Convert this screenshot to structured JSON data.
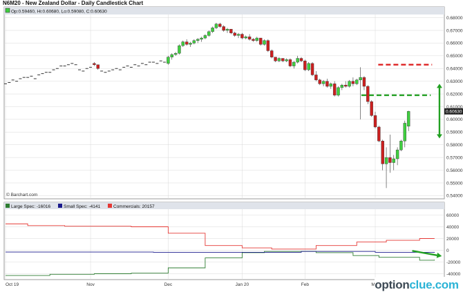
{
  "header": {
    "title": "N6M20 - New Zealand Dollar - Daily Candlestick Chart",
    "ohlc_label": "Op:0.59460, Hi:0.60680, Lo:0.59080, C:0.60630",
    "copyright": "© Barchart.com"
  },
  "watermark": {
    "part1": "option",
    "part2": "clue.com"
  },
  "colors": {
    "up": "#3fcf3f",
    "down": "#cc1f1f",
    "large_spec": "#2e7d32",
    "small_spec": "#1a1a8c",
    "commercials": "#e53935",
    "annotation_red": "#dd2020",
    "annotation_green": "#22a022",
    "grid": "#d8d8d8"
  },
  "chart_data": [
    {
      "type": "candlestick",
      "title": "N6M20 - New Zealand Dollar - Daily Candlestick Chart",
      "ylim": [
        0.5375,
        0.6825
      ],
      "y_ticks": [
        "0.54000",
        "0.55000",
        "0.56000",
        "0.57000",
        "0.58000",
        "0.59000",
        "0.60000",
        "0.61000",
        "0.62000",
        "0.63000",
        "0.64000",
        "0.65000",
        "0.66000",
        "0.67000",
        "0.68000"
      ],
      "last_price": "0.60630",
      "candles": [
        [
          0.628,
          0.628,
          0.628,
          0.628
        ],
        [
          0.629,
          0.629,
          0.629,
          0.629
        ],
        [
          0.631,
          0.631,
          0.631,
          0.631
        ],
        [
          0.63,
          0.63,
          0.63,
          0.63
        ],
        [
          0.632,
          0.632,
          0.632,
          0.632
        ],
        [
          0.633,
          0.633,
          0.633,
          0.633
        ],
        [
          0.633,
          0.633,
          0.633,
          0.633
        ],
        [
          0.634,
          0.634,
          0.634,
          0.634
        ],
        [
          0.632,
          0.632,
          0.632,
          0.632
        ],
        [
          0.635,
          0.635,
          0.635,
          0.635
        ],
        [
          0.636,
          0.636,
          0.636,
          0.636
        ],
        [
          0.637,
          0.637,
          0.637,
          0.637
        ],
        [
          0.637,
          0.637,
          0.637,
          0.637
        ],
        [
          0.639,
          0.639,
          0.639,
          0.639
        ],
        [
          0.64,
          0.64,
          0.64,
          0.64
        ],
        [
          0.642,
          0.642,
          0.642,
          0.642
        ],
        [
          0.642,
          0.642,
          0.642,
          0.642
        ],
        [
          0.643,
          0.643,
          0.643,
          0.643
        ],
        [
          0.644,
          0.644,
          0.644,
          0.644
        ],
        [
          0.643,
          0.643,
          0.643,
          0.643
        ],
        [
          0.639,
          0.639,
          0.639,
          0.639
        ],
        [
          0.638,
          0.638,
          0.638,
          0.638
        ],
        [
          0.64,
          0.64,
          0.64,
          0.64
        ],
        [
          0.641,
          0.641,
          0.641,
          0.641
        ],
        [
          0.644,
          0.645,
          0.642,
          0.643
        ],
        [
          0.643,
          0.643,
          0.639,
          0.64
        ],
        [
          0.638,
          0.638,
          0.638,
          0.638
        ],
        [
          0.637,
          0.637,
          0.637,
          0.637
        ],
        [
          0.638,
          0.638,
          0.638,
          0.638
        ],
        [
          0.639,
          0.639,
          0.639,
          0.639
        ],
        [
          0.64,
          0.64,
          0.64,
          0.64
        ],
        [
          0.639,
          0.639,
          0.639,
          0.639
        ],
        [
          0.641,
          0.641,
          0.641,
          0.641
        ],
        [
          0.642,
          0.642,
          0.642,
          0.642
        ],
        [
          0.641,
          0.641,
          0.641,
          0.641
        ],
        [
          0.643,
          0.643,
          0.643,
          0.643
        ],
        [
          0.642,
          0.642,
          0.642,
          0.642
        ],
        [
          0.644,
          0.644,
          0.644,
          0.644
        ],
        [
          0.643,
          0.643,
          0.643,
          0.643
        ],
        [
          0.645,
          0.645,
          0.645,
          0.645
        ],
        [
          0.645,
          0.645,
          0.645,
          0.645
        ],
        [
          0.644,
          0.644,
          0.644,
          0.644
        ],
        [
          0.646,
          0.646,
          0.646,
          0.646
        ],
        [
          0.645,
          0.645,
          0.645,
          0.645
        ],
        [
          0.644,
          0.65,
          0.643,
          0.649
        ],
        [
          0.649,
          0.652,
          0.647,
          0.651
        ],
        [
          0.651,
          0.653,
          0.65,
          0.652
        ],
        [
          0.652,
          0.659,
          0.651,
          0.658
        ],
        [
          0.658,
          0.662,
          0.657,
          0.661
        ],
        [
          0.661,
          0.663,
          0.658,
          0.659
        ],
        [
          0.659,
          0.661,
          0.657,
          0.66
        ],
        [
          0.66,
          0.663,
          0.659,
          0.662
        ],
        [
          0.662,
          0.664,
          0.66,
          0.663
        ],
        [
          0.663,
          0.665,
          0.661,
          0.664
        ],
        [
          0.664,
          0.667,
          0.663,
          0.666
        ],
        [
          0.666,
          0.67,
          0.665,
          0.669
        ],
        [
          0.669,
          0.673,
          0.668,
          0.672
        ],
        [
          0.672,
          0.676,
          0.671,
          0.675
        ],
        [
          0.675,
          0.676,
          0.672,
          0.673
        ],
        [
          0.673,
          0.674,
          0.669,
          0.67
        ],
        [
          0.67,
          0.672,
          0.668,
          0.671
        ],
        [
          0.671,
          0.671,
          0.667,
          0.668
        ],
        [
          0.668,
          0.669,
          0.665,
          0.666
        ],
        [
          0.666,
          0.668,
          0.664,
          0.667
        ],
        [
          0.667,
          0.668,
          0.663,
          0.664
        ],
        [
          0.664,
          0.666,
          0.663,
          0.665
        ],
        [
          0.665,
          0.667,
          0.662,
          0.663
        ],
        [
          0.663,
          0.664,
          0.661,
          0.662
        ],
        [
          0.662,
          0.665,
          0.661,
          0.664
        ],
        [
          0.664,
          0.664,
          0.658,
          0.659
        ],
        [
          0.659,
          0.663,
          0.658,
          0.662
        ],
        [
          0.662,
          0.663,
          0.653,
          0.654
        ],
        [
          0.654,
          0.655,
          0.648,
          0.649
        ],
        [
          0.649,
          0.649,
          0.645,
          0.646
        ],
        [
          0.646,
          0.649,
          0.645,
          0.648
        ],
        [
          0.648,
          0.648,
          0.645,
          0.646
        ],
        [
          0.646,
          0.648,
          0.645,
          0.647
        ],
        [
          0.647,
          0.648,
          0.641,
          0.642
        ],
        [
          0.642,
          0.646,
          0.64,
          0.645
        ],
        [
          0.645,
          0.65,
          0.644,
          0.648
        ],
        [
          0.648,
          0.649,
          0.645,
          0.646
        ],
        [
          0.646,
          0.647,
          0.638,
          0.639
        ],
        [
          0.639,
          0.645,
          0.638,
          0.644
        ],
        [
          0.644,
          0.645,
          0.634,
          0.635
        ],
        [
          0.635,
          0.638,
          0.63,
          0.631
        ],
        [
          0.631,
          0.632,
          0.627,
          0.628
        ],
        [
          0.628,
          0.631,
          0.626,
          0.63
        ],
        [
          0.63,
          0.632,
          0.625,
          0.626
        ],
        [
          0.626,
          0.629,
          0.624,
          0.628
        ],
        [
          0.628,
          0.63,
          0.618,
          0.619
        ],
        [
          0.619,
          0.626,
          0.618,
          0.625
        ],
        [
          0.625,
          0.628,
          0.623,
          0.627
        ],
        [
          0.627,
          0.63,
          0.625,
          0.626
        ],
        [
          0.626,
          0.631,
          0.625,
          0.63
        ],
        [
          0.63,
          0.633,
          0.626,
          0.628
        ],
        [
          0.628,
          0.632,
          0.627,
          0.631
        ],
        [
          0.631,
          0.641,
          0.6,
          0.633
        ],
        [
          0.633,
          0.634,
          0.623,
          0.626
        ],
        [
          0.626,
          0.627,
          0.612,
          0.614
        ],
        [
          0.614,
          0.615,
          0.602,
          0.603
        ],
        [
          0.603,
          0.606,
          0.593,
          0.594
        ],
        [
          0.594,
          0.595,
          0.582,
          0.583
        ],
        [
          0.583,
          0.584,
          0.56,
          0.565
        ],
        [
          0.565,
          0.578,
          0.546,
          0.57
        ],
        [
          0.57,
          0.588,
          0.558,
          0.566
        ],
        [
          0.566,
          0.572,
          0.56,
          0.569
        ],
        [
          0.569,
          0.578,
          0.564,
          0.576
        ],
        [
          0.576,
          0.584,
          0.575,
          0.583
        ],
        [
          0.583,
          0.599,
          0.578,
          0.597
        ],
        [
          0.5946,
          0.6068,
          0.5908,
          0.6063
        ]
      ],
      "annotations": {
        "red_dashed_level": 0.643,
        "green_dashed_level": 0.619,
        "green_arrow_from": 0.628,
        "green_arrow_to": 0.585
      }
    },
    {
      "type": "line",
      "title": "",
      "ylim": [
        -50000,
        70000
      ],
      "y_ticks": [
        "60000",
        "40000",
        "20000",
        "0",
        "-20000",
        "-40000"
      ],
      "x_labels": [
        {
          "label": "Oct 19",
          "index": 0
        },
        {
          "label": "Nov",
          "index": 23
        },
        {
          "label": "Dec",
          "index": 44
        },
        {
          "label": "Jan 20",
          "index": 64
        },
        {
          "label": "Feb",
          "index": 81
        },
        {
          "label": "Mar",
          "index": 100
        }
      ],
      "series": [
        {
          "name": "Large Spec",
          "legend_label": "Large Spec: -16016",
          "key": "large_spec",
          "points": [
            [
              0,
              -43000
            ],
            [
              12,
              -41000
            ],
            [
              24,
              -40000
            ],
            [
              34,
              -39000
            ],
            [
              44,
              -30000
            ],
            [
              54,
              -13000
            ],
            [
              64,
              -4000
            ],
            [
              70,
              -2000
            ],
            [
              84,
              -4000
            ],
            [
              94,
              -9000
            ],
            [
              101,
              -12000
            ],
            [
              112,
              -17000
            ],
            [
              116,
              -16016
            ]
          ]
        },
        {
          "name": "Small Spec",
          "legend_label": "Small Spec: -4141",
          "key": "small_spec",
          "points": [
            [
              0,
              -3000
            ],
            [
              40,
              -3500
            ],
            [
              80,
              -2000
            ],
            [
              100,
              -3500
            ],
            [
              116,
              -4141
            ]
          ]
        },
        {
          "name": "Commercials",
          "legend_label": "Commercials: 20157",
          "key": "commercials",
          "points": [
            [
              0,
              45000
            ],
            [
              6,
              42000
            ],
            [
              16,
              41000
            ],
            [
              34,
              40000
            ],
            [
              44,
              29000
            ],
            [
              54,
              8000
            ],
            [
              64,
              4000
            ],
            [
              72,
              2000
            ],
            [
              84,
              8000
            ],
            [
              95,
              14000
            ],
            [
              103,
              17000
            ],
            [
              112,
              20000
            ],
            [
              116,
              20157
            ]
          ]
        }
      ],
      "annotation_arrow": {
        "from": [
          110,
          -1000
        ],
        "to": [
          118,
          -10000
        ]
      }
    }
  ]
}
